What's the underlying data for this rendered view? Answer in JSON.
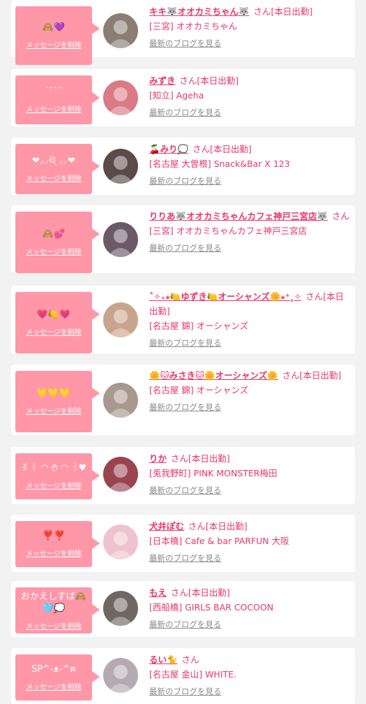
{
  "delete_label": "メッセージを削除",
  "blog_label": "最新のブログを見る",
  "cards": [
    {
      "message": "🙈💜",
      "name": "キキ🐺オオカミちゃん🐺",
      "suffix": "さん[本日出勤]",
      "shop": "[三宮] オオカミちゃん",
      "avatar_color": "#8b7d73"
    },
    {
      "message": "ˊ˘ˋ˘",
      "name": "みずき",
      "suffix": "さん[本日出勤]",
      "shop": "[知立] Ageha",
      "avatar_color": "#d97a84"
    },
    {
      "message": "❤︎⸝⸝ᐛ ̖⸝⸝❤︎",
      "name": "🍒みり💭",
      "suffix": "さん[本日出勤]",
      "shop": "[名古屋 大曽根] Snack&Bar X 123",
      "avatar_color": "#5b4a4a"
    },
    {
      "message": "🙈💕",
      "name": "りりあ🐺オオカミちゃんカフェ神戸三宮店🐺",
      "suffix": "さん",
      "shop": "[三宮] オオカミちゃんカフェ神戸三宮店",
      "avatar_color": "#6b5a66"
    },
    {
      "message": "💗🍋💗",
      "name": "˚✧₊⁎🍋ゆずき🍋オーシャンズ🌼⁎⁺˳✧",
      "suffix": "さん[本日出勤]",
      "shop": "[名古屋 錦] オーシャンズ",
      "avatar_color": "#c9a48c"
    },
    {
      "message": "💛💛💛",
      "name": "🌼🐱みさき🐱🌼オーシャンズ🌼",
      "suffix": "さん[本日出勤]",
      "shop": "[名古屋 錦] オーシャンズ",
      "avatar_color": "#a8988d"
    },
    {
      "message": "ꉂ ꒰ ◠ ࿉ ◠ ꒱♥",
      "name": "りか",
      "suffix": "さん[本日出勤]",
      "shop": "[兎我野町] PINK MONSTER梅田",
      "avatar_color": "#9a4450"
    },
    {
      "message": "❣️❣️",
      "name": "犬井ぽむ",
      "suffix": "さん[本日出勤]",
      "shop": "[日本橋] Cafe & bar PARFUN 大阪",
      "avatar_color": "#efc2cf"
    },
    {
      "message": "おかえしすば🙈🩵💭",
      "name": "もえ",
      "suffix": "さん[本日出勤]",
      "shop": "[西船橋] GIRLS BAR COCOON",
      "avatar_color": "#6e6762"
    },
    {
      "message": "SP^-ᴥ-^ฅ",
      "name": "るい🐈",
      "suffix": "さん",
      "shop": "[名古屋 金山] WHITE.",
      "avatar_color": "#b6aab2"
    }
  ]
}
